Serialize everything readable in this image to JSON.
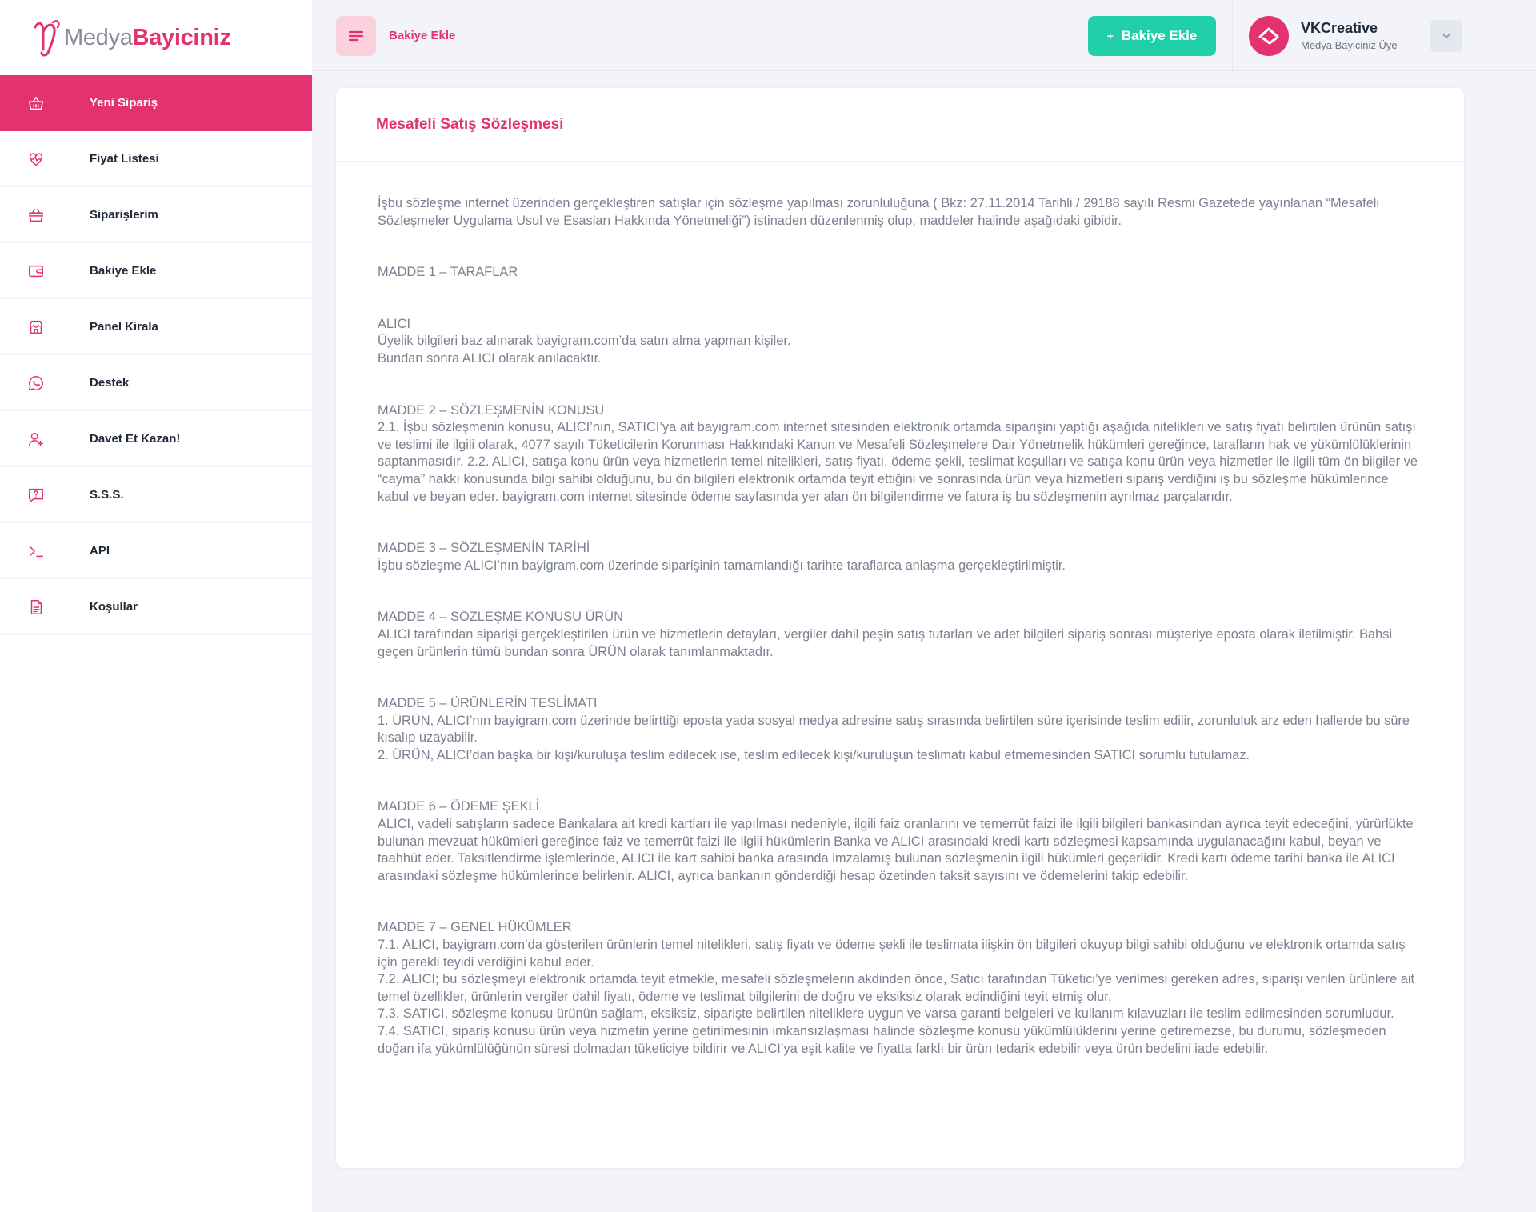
{
  "brand": {
    "name_light": "Medya",
    "name_bold": "Bayiciniz"
  },
  "sidebar": {
    "items": [
      {
        "label": "Yeni Sipariş",
        "icon": "basket-icon",
        "active": true
      },
      {
        "label": "Fiyat Listesi",
        "icon": "heart-pulse-icon"
      },
      {
        "label": "Siparişlerim",
        "icon": "shopping-basket-icon"
      },
      {
        "label": "Bakiye Ekle",
        "icon": "wallet-icon"
      },
      {
        "label": "Panel Kirala",
        "icon": "store-icon"
      },
      {
        "label": "Destek",
        "icon": "chat-icon"
      },
      {
        "label": "Davet Et Kazan!",
        "icon": "user-plus-icon"
      },
      {
        "label": "S.S.S.",
        "icon": "question-icon"
      },
      {
        "label": "API",
        "icon": "terminal-icon"
      },
      {
        "label": "Koşullar",
        "icon": "document-icon"
      }
    ]
  },
  "header": {
    "breadcrumb": "Bakiye Ekle",
    "add_button": "Bakiye Ekle",
    "add_button_plus": "+",
    "user": {
      "name": "VKCreative",
      "role": "Medya Bayiciniz Üye"
    }
  },
  "colors": {
    "accent": "#e4326e",
    "success": "#1ecfa7",
    "background": "#f3f4f9"
  },
  "card": {
    "title": "Mesafeli Satış Sözleşmesi",
    "intro": "İşbu sözleşme internet üzerinden gerçekleştiren satışlar için sözleşme yapılması zorunluluğuna ( Bkz: 27.11.2014 Tarihli / 29188 sayılı Resmi Gazetede yayınlanan “Mesafeli Sözleşmeler Uygulama Usul ve Esasları Hakkında Yönetmeliği”) istinaden düzenlenmiş olup, maddeler halinde aşağıdaki gibidir.",
    "madde1_title": "MADDE 1 – TARAFLAR",
    "alici_title": "ALICI",
    "alici_l1": "Üyelik bilgileri baz alınarak bayigram.com’da satın alma yapman kişiler.",
    "alici_l2": "Bundan sonra ALICI olarak anılacaktır.",
    "madde2_title": "MADDE 2 – SÖZLEŞMENİN KONUSU",
    "madde2_text": "2.1. İşbu sözleşmenin konusu, ALICI’nın, SATICI’ya ait bayigram.com internet sitesinden elektronik ortamda siparişini yaptığı aşağıda nitelikleri ve satış fiyatı belirtilen ürünün satışı ve teslimi ile ilgili olarak, 4077 sayılı Tüketicilerin Korunması Hakkındaki Kanun ve Mesafeli Sözleşmelere Dair Yönetmelik hükümleri gereğince, tarafların hak ve yükümlülüklerinin saptanmasıdır. 2.2. ALICI, satışa konu ürün veya hizmetlerin temel nitelikleri, satış fiyatı, ödeme şekli, teslimat koşulları ve satışa konu ürün veya hizmetler ile ilgili tüm ön bilgiler ve “cayma” hakkı konusunda bilgi sahibi olduğunu, bu ön bilgileri elektronik ortamda teyit ettiğini ve sonrasında ürün veya hizmetleri sipariş verdiğini iş bu sözleşme hükümlerince kabul ve beyan eder. bayigram.com internet sitesinde ödeme sayfasında yer alan ön bilgilendirme ve fatura iş bu sözleşmenin ayrılmaz parçalarıdır.",
    "madde3_title": "MADDE 3 – SÖZLEŞMENİN TARİHİ",
    "madde3_text": "İşbu sözleşme ALICI’nın bayigram.com üzerinde siparişinin tamamlandığı tarihte taraflarca anlaşma gerçekleştirilmiştir.",
    "madde4_title": "MADDE 4 – SÖZLEŞME KONUSU ÜRÜN",
    "madde4_text": "ALICI tarafından siparişi gerçekleştirilen ürün ve hizmetlerin detayları, vergiler dahil peşin satış tutarları ve adet bilgileri sipariş sonrası müşteriye eposta olarak iletilmiştir. Bahsi geçen ürünlerin tümü bundan sonra ÜRÜN olarak tanımlanmaktadır.",
    "madde5_title": "MADDE 5 – ÜRÜNLERİN TESLİMATI",
    "madde5_l1": "1. ÜRÜN, ALICI’nın bayigram.com üzerinde belirttiği eposta yada sosyal medya adresine satış sırasında belirtilen süre içerisinde teslim edilir, zorunluluk arz eden hallerde bu süre kısalıp uzayabilir.",
    "madde5_l2": "2. ÜRÜN, ALICI’dan başka bir kişi/kuruluşa teslim edilecek ise, teslim edilecek kişi/kuruluşun teslimatı kabul etmemesinden SATICI sorumlu tutulamaz.",
    "madde6_title": "MADDE 6 – ÖDEME ŞEKLİ",
    "madde6_text": "ALICI, vadeli satışların sadece Bankalara ait kredi kartları ile yapılması nedeniyle, ilgili faiz oranlarını ve temerrüt faizi ile ilgili bilgileri bankasından ayrıca teyit edeceğini, yürürlükte bulunan mevzuat hükümleri gereğince faiz ve temerrüt faizi ile ilgili hükümlerin Banka ve ALICI arasındaki kredi kartı sözleşmesi kapsamında uygulanacağını kabul, beyan ve taahhüt eder. Taksitlendirme işlemlerinde, ALICI ile kart sahibi banka arasında imzalamış bulunan sözleşmenin ilgili hükümleri geçerlidir. Kredi kartı ödeme tarihi banka ile ALICI arasındaki sözleşme hükümlerince belirlenir. ALICI, ayrıca bankanın gönderdiği hesap özetinden taksit sayısını ve ödemelerini takip edebilir.",
    "madde7_title": "MADDE 7 – GENEL HÜKÜMLER",
    "madde7_l1": "7.1. ALICI, bayigram.com’da gösterilen ürünlerin temel nitelikleri, satış fiyatı ve ödeme şekli ile teslimata ilişkin ön bilgileri okuyup bilgi sahibi olduğunu ve elektronik ortamda satış için gerekli teyidi verdiğini kabul eder.",
    "madde7_l2": "7.2. ALICI; bu sözleşmeyi elektronik ortamda teyit etmekle, mesafeli sözleşmelerin akdinden önce, Satıcı tarafından Tüketici’ye verilmesi gereken adres, siparişi verilen ürünlere ait temel özellikler, ürünlerin vergiler dahil fiyatı, ödeme ve teslimat bilgilerini de doğru ve eksiksiz olarak edindiğini teyit etmiş olur.",
    "madde7_l3": "7.3. SATICI, sözleşme konusu ürünün sağlam, eksiksiz, siparişte belirtilen niteliklere uygun ve varsa garanti belgeleri ve kullanım kılavuzları ile teslim edilmesinden sorumludur.",
    "madde7_l4": "7.4. SATICI, sipariş konusu ürün veya hizmetin yerine getirilmesinin imkansızlaşması halinde sözleşme konusu yükümlülüklerini yerine getiremezse, bu durumu, sözleşmeden doğan ifa yükümlülüğünün süresi dolmadan tüketiciye bildirir ve ALICI’ya eşit kalite ve fiyatta farklı bir ürün tedarik edebilir veya ürün bedelini iade edebilir."
  }
}
